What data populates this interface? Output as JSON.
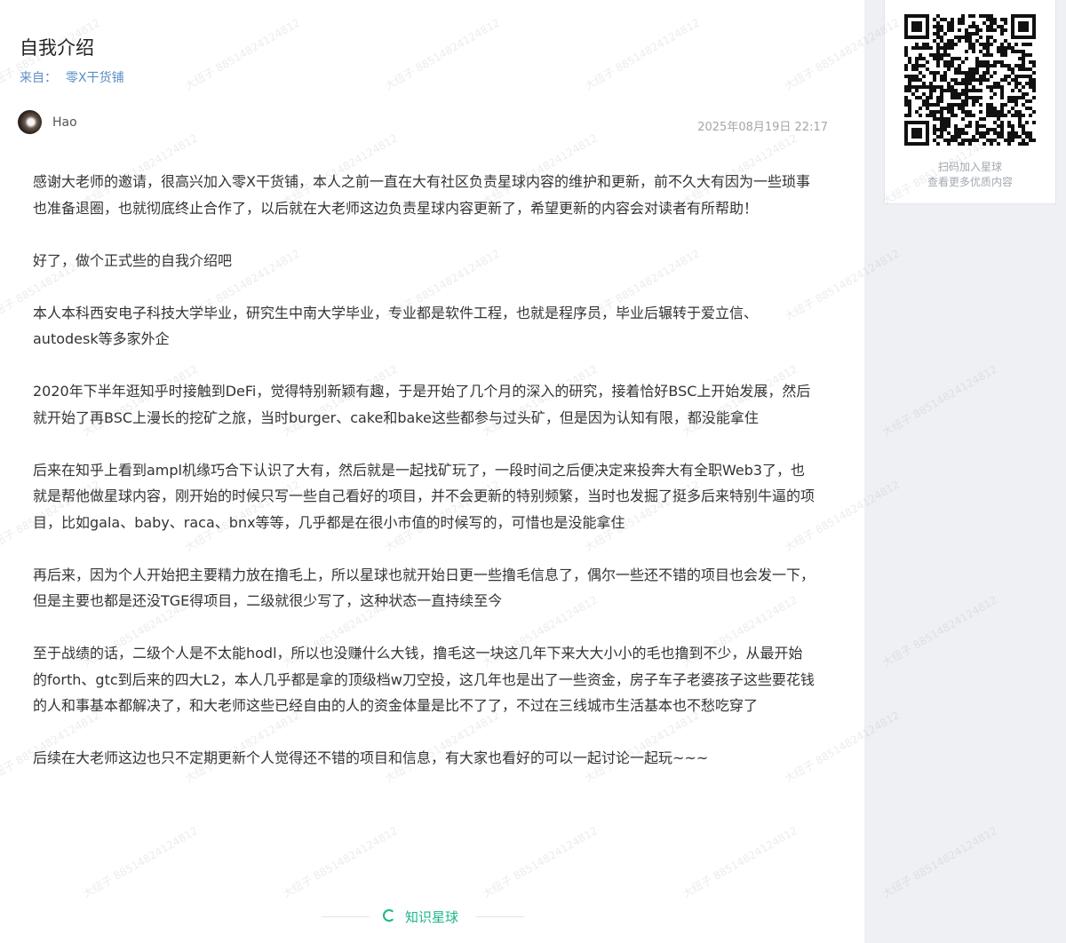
{
  "article": {
    "title": "自我介绍",
    "from_label": "来自：",
    "from_source": "零X干货铺",
    "author": "Hao",
    "timestamp": "2025年08月19日 22:17",
    "paragraphs": [
      "感谢大老师的邀请，很高兴加入零X干货铺，本人之前一直在大有社区负责星球内容的维护和更新，前不久大有因为一些琐事也准备退圈，也就彻底终止合作了，以后就在大老师这边负责星球内容更新了，希望更新的内容会对读者有所帮助！",
      "好了，做个正式些的自我介绍吧",
      "本人本科西安电子科技大学毕业，研究生中南大学毕业，专业都是软件工程，也就是程序员，毕业后辗转于爱立信、autodesk等多家外企",
      "2020年下半年逛知乎时接触到DeFi，觉得特别新颖有趣，于是开始了几个月的深入的研究，接着恰好BSC上开始发展，然后就开始了再BSC上漫长的挖矿之旅，当时burger、cake和bake这些都参与过头矿，但是因为认知有限，都没能拿住",
      "后来在知乎上看到ampl机缘巧合下认识了大有，然后就是一起找矿玩了，一段时间之后便决定来投奔大有全职Web3了，也就是帮他做星球内容，刚开始的时候只写一些自己看好的项目，并不会更新的特别频繁，当时也发掘了挺多后来特别牛逼的项目，比如gala、baby、raca、bnx等等，几乎都是在很小市值的时候写的，可惜也是没能拿住",
      "再后来，因为个人开始把主要精力放在撸毛上，所以星球也就开始日更一些撸毛信息了，偶尔一些还不错的项目也会发一下，但是主要也都是还没TGE得项目，二级就很少写了，这种状态一直持续至今",
      "至于战绩的话，二级个人是不太能hodl，所以也没赚什么大钱，撸毛这一块这几年下来大大小小的毛也撸到不少，从最开始的forth、gtc到后来的四大L2，本人几乎都是拿的顶级档w刀空投，这几年也是出了一些资金，房子车子老婆孩子这些要花钱的人和事基本都解决了，和大老师这些已经自由的人的资金体量是比不了了，不过在三线城市生活基本也不愁吃穿了",
      "后续在大老师这边也只不定期更新个人觉得还不错的项目和信息，有大家也看好的可以一起讨论一起玩~~~"
    ]
  },
  "sidebar": {
    "qr_icon": "qr-code-icon",
    "caption_line1": "扫码加入星球",
    "caption_line2": "查看更多优质内容"
  },
  "footer": {
    "brand_icon": "knowledge-planet-logo-icon",
    "brand": "知识星球",
    "brand_color": "#1bb78c"
  },
  "watermark": {
    "text": "大纽子 8851482412481​2"
  },
  "colors": {
    "link": "#5a8fc6",
    "sidebar_bg": "#eef0f3"
  }
}
